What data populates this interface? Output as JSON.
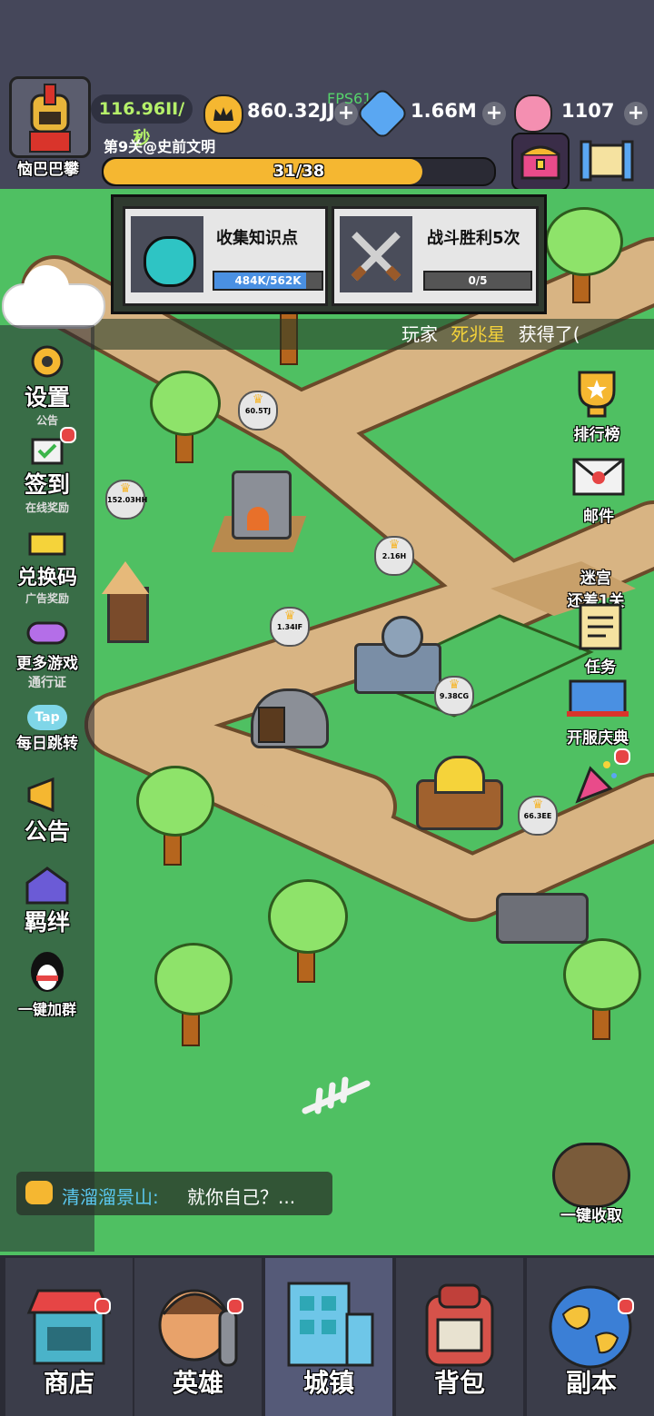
{
  "player": {
    "name": "恼巴巴攀",
    "rate": "116.96II/秒",
    "stage": "第9关@史前文明",
    "progress_text": "31/38",
    "progress": 0.816
  },
  "currencies": {
    "crowns": "860.32JJ",
    "fps": "FPS61",
    "gems": "1.66M",
    "candy": "1107"
  },
  "quests": [
    {
      "title": "收集知识点",
      "progress_text": "484K/562K",
      "progress": 0.86,
      "icon": "pot-icon"
    },
    {
      "title": "战斗胜利5次",
      "progress_text": "0/5",
      "progress": 0.0,
      "icon": "crossed-swords-icon"
    }
  ],
  "ticker": {
    "prefix": "玩家",
    "name": "死兆星",
    "suffix": "获得了("
  },
  "left_menu": [
    {
      "label": "设置",
      "sub": "公告"
    },
    {
      "label": "签到",
      "sub": "在线奖励"
    },
    {
      "label": "兑换码",
      "sub": "广告奖励"
    },
    {
      "label": "更多游戏",
      "sub": "通行证"
    },
    {
      "label": "每日跳转",
      "sub": ""
    },
    {
      "label": "公告",
      "sub": ""
    },
    {
      "label": "羁绊",
      "sub": ""
    },
    {
      "label": "一键加群",
      "sub": ""
    }
  ],
  "right_menu": {
    "ranking": "排行榜",
    "mail": "邮件",
    "maze": "迷宫",
    "maze_sub": "还差1关",
    "task": "任务",
    "celebration": "开服庆典",
    "collect": "一键收取"
  },
  "building_labels": [
    "60.5TJ",
    "152.03HH",
    "2.16H",
    "1.34IF",
    "9.38CG",
    "66.3EE"
  ],
  "chat": {
    "speaker": "清溜溜景山:",
    "message": "就你自己？..."
  },
  "nav": [
    {
      "label": "商店",
      "icon": "shop-icon"
    },
    {
      "label": "英雄",
      "icon": "hero-icon"
    },
    {
      "label": "城镇",
      "icon": "town-icon"
    },
    {
      "label": "背包",
      "icon": "backpack-icon"
    },
    {
      "label": "副本",
      "icon": "globe-icon"
    }
  ],
  "colors": {
    "accent": "#f5b731",
    "grass": "#4fc062",
    "path": "#d8b483",
    "name_highlight": "#f5d33a"
  }
}
